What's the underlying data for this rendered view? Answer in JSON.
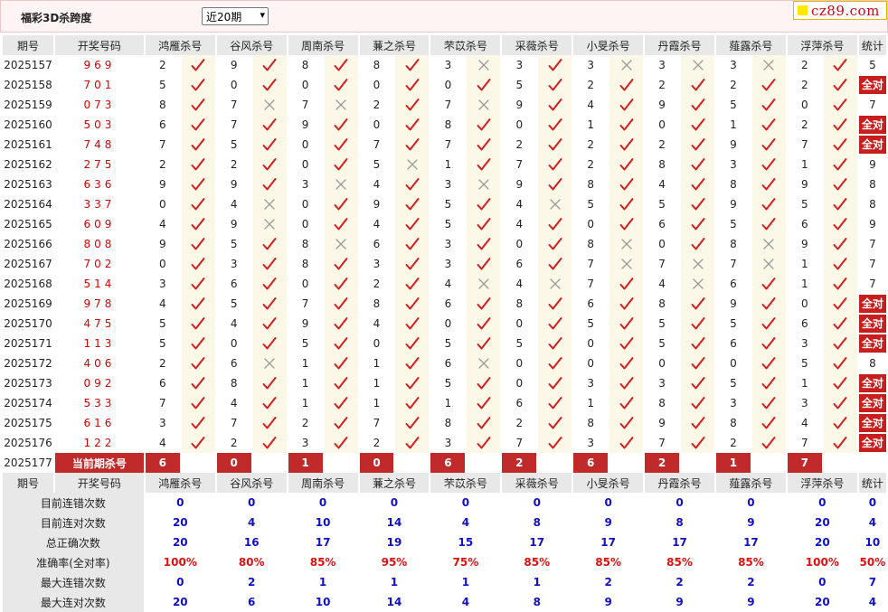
{
  "header": {
    "title": "福彩3D杀跨度",
    "period_select": "近20期",
    "brand_text": "cz89.com"
  },
  "columns": {
    "issue": "期号",
    "draw": "开奖号码",
    "experts": [
      "鸿雁杀号",
      "谷风杀号",
      "周南杀号",
      "蒹之杀号",
      "芣苡杀号",
      "采薇杀号",
      "小旻杀号",
      "丹霞杀号",
      "薤露杀号",
      "浮萍杀号"
    ],
    "stat": "统计"
  },
  "all_correct_label": "全对",
  "rows": [
    {
      "issue": "2025157",
      "draw": "969",
      "nums": [
        "2",
        "9",
        "8",
        "8",
        "3",
        "3",
        "3",
        "3",
        "3",
        "2"
      ],
      "marks": [
        1,
        1,
        1,
        1,
        0,
        1,
        0,
        0,
        0,
        1
      ],
      "stat": "5"
    },
    {
      "issue": "2025158",
      "draw": "701",
      "nums": [
        "5",
        "0",
        "0",
        "0",
        "0",
        "5",
        "2",
        "2",
        "2",
        "2"
      ],
      "marks": [
        1,
        1,
        1,
        1,
        1,
        1,
        1,
        1,
        1,
        1
      ],
      "stat": "全对"
    },
    {
      "issue": "2025159",
      "draw": "073",
      "nums": [
        "8",
        "7",
        "7",
        "2",
        "7",
        "9",
        "4",
        "9",
        "5",
        "0"
      ],
      "marks": [
        1,
        0,
        0,
        1,
        0,
        1,
        1,
        1,
        1,
        1
      ],
      "stat": "7"
    },
    {
      "issue": "2025160",
      "draw": "503",
      "nums": [
        "6",
        "7",
        "9",
        "0",
        "8",
        "0",
        "1",
        "0",
        "1",
        "2"
      ],
      "marks": [
        1,
        1,
        1,
        1,
        1,
        1,
        1,
        1,
        1,
        1
      ],
      "stat": "全对"
    },
    {
      "issue": "2025161",
      "draw": "748",
      "nums": [
        "7",
        "5",
        "0",
        "7",
        "7",
        "2",
        "2",
        "2",
        "9",
        "7"
      ],
      "marks": [
        1,
        1,
        1,
        1,
        1,
        1,
        1,
        1,
        1,
        1
      ],
      "stat": "全对"
    },
    {
      "issue": "2025162",
      "draw": "275",
      "nums": [
        "2",
        "2",
        "0",
        "5",
        "1",
        "7",
        "2",
        "8",
        "3",
        "1"
      ],
      "marks": [
        1,
        1,
        1,
        0,
        1,
        1,
        1,
        1,
        1,
        1
      ],
      "stat": "9"
    },
    {
      "issue": "2025163",
      "draw": "636",
      "nums": [
        "9",
        "9",
        "3",
        "4",
        "3",
        "9",
        "8",
        "4",
        "8",
        "9"
      ],
      "marks": [
        1,
        1,
        0,
        1,
        0,
        1,
        1,
        1,
        1,
        1
      ],
      "stat": "8"
    },
    {
      "issue": "2025164",
      "draw": "337",
      "nums": [
        "0",
        "4",
        "0",
        "9",
        "5",
        "4",
        "5",
        "5",
        "9",
        "5"
      ],
      "marks": [
        1,
        0,
        1,
        1,
        1,
        0,
        1,
        1,
        1,
        1
      ],
      "stat": "8"
    },
    {
      "issue": "2025165",
      "draw": "609",
      "nums": [
        "4",
        "9",
        "0",
        "4",
        "5",
        "4",
        "0",
        "6",
        "5",
        "6"
      ],
      "marks": [
        1,
        0,
        1,
        1,
        1,
        1,
        1,
        1,
        1,
        1
      ],
      "stat": "9"
    },
    {
      "issue": "2025166",
      "draw": "808",
      "nums": [
        "9",
        "5",
        "8",
        "6",
        "3",
        "0",
        "8",
        "0",
        "8",
        "9"
      ],
      "marks": [
        1,
        1,
        0,
        1,
        1,
        1,
        0,
        1,
        0,
        1
      ],
      "stat": "7"
    },
    {
      "issue": "2025167",
      "draw": "702",
      "nums": [
        "0",
        "3",
        "8",
        "3",
        "3",
        "6",
        "7",
        "7",
        "7",
        "1"
      ],
      "marks": [
        1,
        1,
        1,
        1,
        1,
        1,
        0,
        0,
        0,
        1
      ],
      "stat": "7"
    },
    {
      "issue": "2025168",
      "draw": "514",
      "nums": [
        "3",
        "6",
        "0",
        "2",
        "4",
        "4",
        "7",
        "4",
        "6",
        "1"
      ],
      "marks": [
        1,
        1,
        1,
        1,
        0,
        0,
        1,
        0,
        1,
        1
      ],
      "stat": "7"
    },
    {
      "issue": "2025169",
      "draw": "978",
      "nums": [
        "4",
        "5",
        "7",
        "8",
        "6",
        "8",
        "6",
        "8",
        "9",
        "0"
      ],
      "marks": [
        1,
        1,
        1,
        1,
        1,
        1,
        1,
        1,
        1,
        1
      ],
      "stat": "全对"
    },
    {
      "issue": "2025170",
      "draw": "475",
      "nums": [
        "5",
        "4",
        "9",
        "4",
        "0",
        "0",
        "5",
        "5",
        "5",
        "6"
      ],
      "marks": [
        1,
        1,
        1,
        1,
        1,
        1,
        1,
        1,
        1,
        1
      ],
      "stat": "全对"
    },
    {
      "issue": "2025171",
      "draw": "113",
      "nums": [
        "5",
        "0",
        "5",
        "0",
        "5",
        "5",
        "0",
        "5",
        "6",
        "3"
      ],
      "marks": [
        1,
        1,
        1,
        1,
        1,
        1,
        1,
        1,
        1,
        1
      ],
      "stat": "全对"
    },
    {
      "issue": "2025172",
      "draw": "406",
      "nums": [
        "2",
        "6",
        "1",
        "1",
        "6",
        "0",
        "0",
        "0",
        "0",
        "5"
      ],
      "marks": [
        1,
        0,
        1,
        1,
        0,
        1,
        1,
        1,
        1,
        1
      ],
      "stat": "8"
    },
    {
      "issue": "2025173",
      "draw": "092",
      "nums": [
        "6",
        "8",
        "1",
        "1",
        "5",
        "0",
        "3",
        "3",
        "5",
        "1"
      ],
      "marks": [
        1,
        1,
        1,
        1,
        1,
        1,
        1,
        1,
        1,
        1
      ],
      "stat": "全对"
    },
    {
      "issue": "2025174",
      "draw": "533",
      "nums": [
        "7",
        "4",
        "1",
        "1",
        "1",
        "6",
        "1",
        "8",
        "3",
        "3"
      ],
      "marks": [
        1,
        1,
        1,
        1,
        1,
        1,
        1,
        1,
        1,
        1
      ],
      "stat": "全对"
    },
    {
      "issue": "2025175",
      "draw": "616",
      "nums": [
        "3",
        "7",
        "2",
        "7",
        "8",
        "2",
        "8",
        "9",
        "8",
        "4"
      ],
      "marks": [
        1,
        1,
        1,
        1,
        1,
        1,
        1,
        1,
        1,
        1
      ],
      "stat": "全对"
    },
    {
      "issue": "2025176",
      "draw": "122",
      "nums": [
        "4",
        "2",
        "3",
        "2",
        "3",
        "7",
        "3",
        "7",
        "2",
        "7"
      ],
      "marks": [
        1,
        1,
        1,
        1,
        1,
        1,
        1,
        1,
        1,
        1
      ],
      "stat": "全对"
    }
  ],
  "current": {
    "issue": "2025177",
    "label": "当前期杀号",
    "kills": [
      "6",
      "0",
      "1",
      "0",
      "6",
      "2",
      "6",
      "2",
      "1",
      "7"
    ]
  },
  "stats": [
    {
      "label": "目前连错次数",
      "values": [
        "0",
        "0",
        "0",
        "0",
        "0",
        "0",
        "0",
        "0",
        "0",
        "0"
      ],
      "total": "0"
    },
    {
      "label": "目前连对次数",
      "values": [
        "20",
        "4",
        "10",
        "14",
        "4",
        "8",
        "9",
        "8",
        "9",
        "20"
      ],
      "total": "4"
    },
    {
      "label": "总正确次数",
      "values": [
        "20",
        "16",
        "17",
        "19",
        "15",
        "17",
        "17",
        "17",
        "17",
        "20"
      ],
      "total": "10"
    },
    {
      "label": "准确率(全对率)",
      "values": [
        "100%",
        "80%",
        "85%",
        "95%",
        "75%",
        "85%",
        "85%",
        "85%",
        "85%",
        "100%"
      ],
      "total": "50%"
    },
    {
      "label": "最大连错次数",
      "values": [
        "0",
        "2",
        "1",
        "1",
        "1",
        "1",
        "2",
        "2",
        "2",
        "0"
      ],
      "total": "7"
    },
    {
      "label": "最大连对次数",
      "values": [
        "20",
        "6",
        "10",
        "14",
        "4",
        "8",
        "9",
        "9",
        "9",
        "20"
      ],
      "total": "4"
    }
  ],
  "colors": {
    "draw_red": "#d80000",
    "check_red": "#d81e1e",
    "cross_gray": "#9a9a9a",
    "all_correct_bg": "#c91e1e",
    "kill_bg": "#c02a2a",
    "stat_blue": "#1010c8",
    "stat_red": "#e01010",
    "mark_bg": "#fbf8e8",
    "header_bg": "#e8e8e8"
  },
  "icons": {
    "correct": "check-icon",
    "wrong": "cross-icon",
    "dropdown": "chevron-down-icon"
  }
}
